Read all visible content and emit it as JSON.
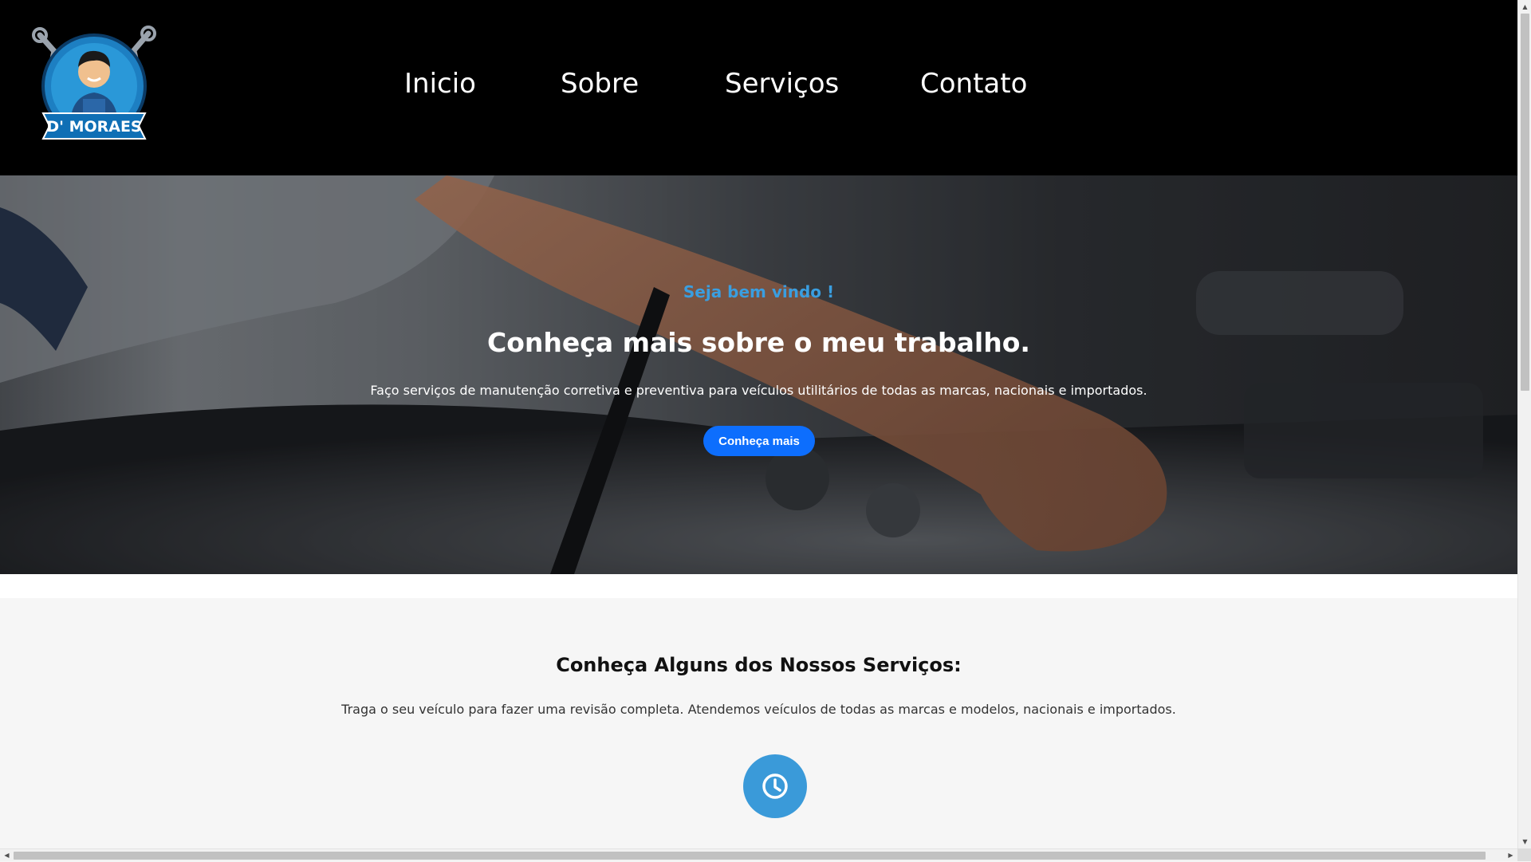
{
  "header": {
    "logo_text": "D'MORAES",
    "nav": [
      {
        "label": "Inicio"
      },
      {
        "label": "Sobre"
      },
      {
        "label": "Serviços"
      },
      {
        "label": "Contato"
      }
    ]
  },
  "hero": {
    "kicker": "Seja bem vindo !",
    "title": "Conheça mais sobre o meu trabalho.",
    "description": "Faço serviços de manutenção corretiva e preventiva para veículos utilitários de todas as marcas, nacionais e importados.",
    "button_label": "Conheça mais"
  },
  "services": {
    "title": "Conheça Alguns dos Nossos Serviços:",
    "description": "Traga o seu veículo para fazer uma revisão completa. Atendemos veículos de todas as marcas e modelos, nacionais e importados.",
    "first_icon": "clock-icon"
  },
  "colors": {
    "header_bg": "#000000",
    "accent_blue": "#3a9ee0",
    "button_blue": "#0d6efd",
    "icon_circle": "#3a9ad9",
    "section_bg": "#f6f6f6"
  }
}
